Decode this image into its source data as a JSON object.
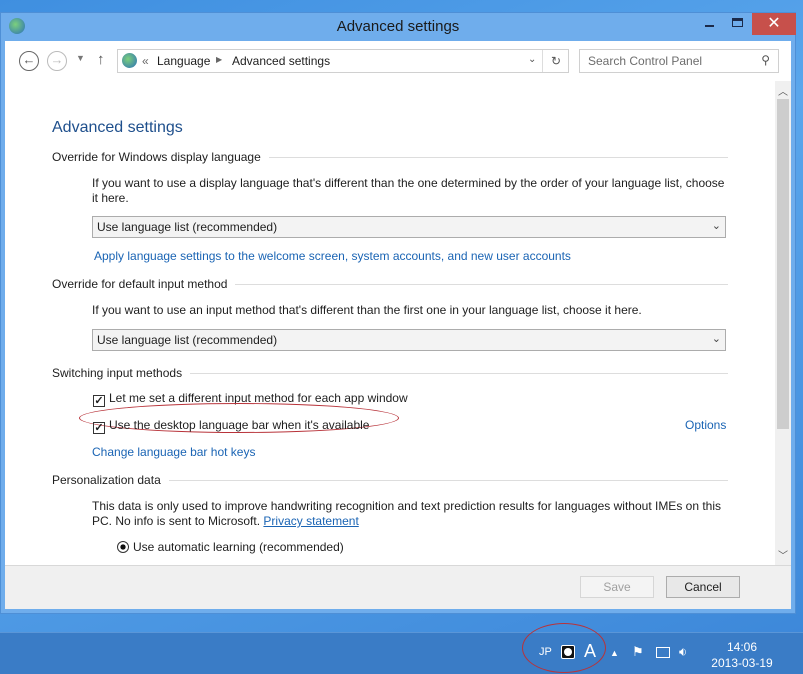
{
  "window": {
    "title": "Advanced settings",
    "minimize_icon": "minimize-icon",
    "maximize_icon": "maximize-icon",
    "close_icon": "close-icon"
  },
  "nav": {
    "breadcrumb": [
      "Language",
      "Advanced settings"
    ],
    "search_placeholder": "Search Control Panel"
  },
  "page": {
    "heading": "Advanced settings",
    "display_language": {
      "title": "Override for Windows display language",
      "description": "If you want to use a display language that's different than the one determined by the order of your language list, choose it here.",
      "selected": "Use language list (recommended)",
      "link": "Apply language settings to the welcome screen, system accounts, and new user accounts"
    },
    "input_method": {
      "title": "Override for default input method",
      "description": "If you want to use an input method that's different than the first one in your language list, choose it here.",
      "selected": "Use language list (recommended)"
    },
    "switching": {
      "title": "Switching input methods",
      "checkbox1": {
        "label": "Let me set a different input method for each app window",
        "checked": true
      },
      "checkbox2": {
        "label": "Use the desktop language bar when it's available",
        "checked": true
      },
      "options_link": "Options",
      "hotkeys_link": "Change language bar hot keys"
    },
    "personalization": {
      "title": "Personalization data",
      "description": "This data is only used to improve handwriting recognition and text prediction results for languages without IMEs on this PC. No info is sent to Microsoft.",
      "privacy_link": "Privacy statement",
      "radio1": {
        "label": "Use automatic learning (recommended)",
        "selected": true
      }
    }
  },
  "footer": {
    "save": "Save",
    "cancel": "Cancel"
  },
  "taskbar": {
    "lang": "JP",
    "ime_mode": "A",
    "time": "14:06",
    "date": "2013-03-19"
  },
  "colors": {
    "accent": "#1a64b4",
    "close": "#c7504b",
    "annotation": "#b8333a"
  }
}
